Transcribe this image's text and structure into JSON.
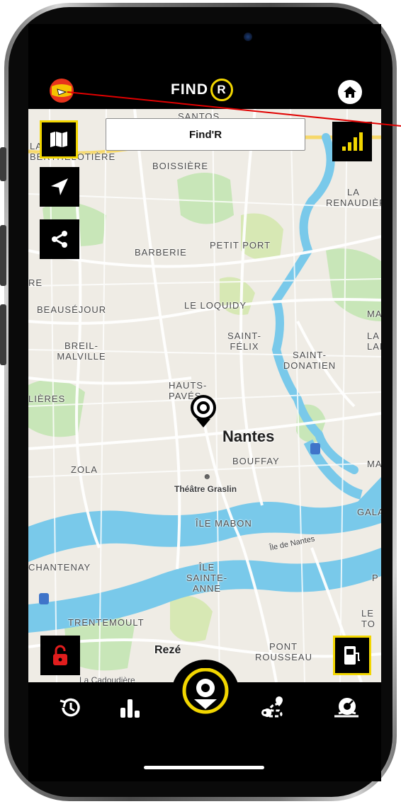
{
  "app": {
    "logo_text": "FIND",
    "logo_mark": "R"
  },
  "header": {
    "left_icon": "flag-avatar-icon",
    "right_icon": "home-icon"
  },
  "search": {
    "value": "Find'R"
  },
  "map": {
    "city": "Nantes",
    "poi": "Théâtre Graslin",
    "poi2": "Île de Nantes",
    "city2": "Rezé",
    "neighborhoods": [
      "SANTOS",
      "LA BERTHELOTIÈRE",
      "BOISSIÈRE",
      "LA RENAUDIÈRE",
      "BARBERIE",
      "PETIT PORT",
      "BEAUSÉJOUR",
      "LE LOQUIDY",
      "MA",
      "SAINT-FÉLIX",
      "LA LAN",
      "BREIL-MALVILLE",
      "SAINT-DONATIEN",
      "HAUTS-PAVÉS",
      "LIÈRES",
      "ZOLA",
      "BOUFFAY",
      "MA",
      "ÎLE MABON",
      "GALA",
      "CHANTENAY",
      "ÎLE SAINTE-ANNE",
      "P",
      "LE TO",
      "TRENTEMOULT",
      "PONT ROUSSEAU",
      "La Cadoudière",
      "RE"
    ]
  },
  "colors": {
    "accent": "#f2d600",
    "water": "#79c9ea",
    "park": "#c8e6b8",
    "lock": "#e11d1d"
  },
  "side_buttons": [
    "map-icon",
    "location-arrow-icon",
    "share-icon"
  ],
  "signal_icon": "signal-bars-icon",
  "lock_icon": "lock-open-icon",
  "fuel_icon": "fuel-pump-icon",
  "nav": [
    "history-icon",
    "stats-icon",
    "locate-icon",
    "route-icon",
    "speedometer-icon"
  ]
}
